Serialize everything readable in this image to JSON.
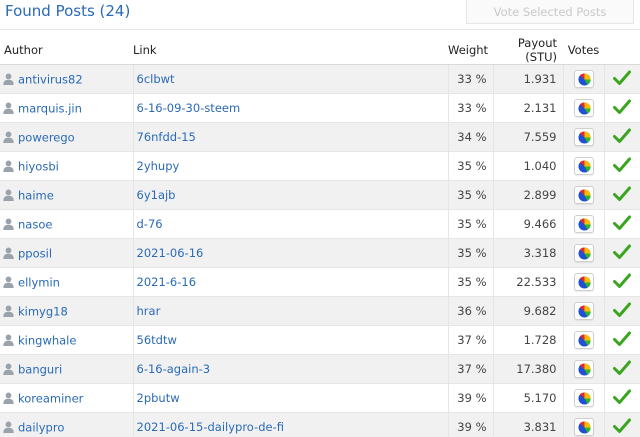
{
  "header": {
    "title": "Found Posts (24)",
    "vote_button_label": "Vote Selected Posts"
  },
  "columns": {
    "author": "Author",
    "link": "Link",
    "weight": "Weight",
    "payout": "Payout (STU)",
    "votes": "Votes"
  },
  "colors": {
    "accent": "#2a6ab8",
    "check": "#3aa51e",
    "row_alt": "#f1f1f1"
  },
  "rows": [
    {
      "author": "antivirus82",
      "link": "6clbwt",
      "weight": "33 %",
      "payout": "1.931"
    },
    {
      "author": "marquis.jin",
      "link": "6-16-09-30-steem",
      "weight": "33 %",
      "payout": "2.131"
    },
    {
      "author": "powerego",
      "link": "76nfdd-15",
      "weight": "34 %",
      "payout": "7.559"
    },
    {
      "author": "hiyosbi",
      "link": "2yhupy",
      "weight": "35 %",
      "payout": "1.040"
    },
    {
      "author": "haime",
      "link": "6y1ajb",
      "weight": "35 %",
      "payout": "2.899"
    },
    {
      "author": "nasoe",
      "link": "d-76",
      "weight": "35 %",
      "payout": "9.466"
    },
    {
      "author": "pposil",
      "link": "2021-06-16",
      "weight": "35 %",
      "payout": "3.318"
    },
    {
      "author": "ellymin",
      "link": "2021-6-16",
      "weight": "35 %",
      "payout": "22.533"
    },
    {
      "author": "kimyg18",
      "link": "hrar",
      "weight": "36 %",
      "payout": "9.682"
    },
    {
      "author": "kingwhale",
      "link": "56tdtw",
      "weight": "37 %",
      "payout": "1.728"
    },
    {
      "author": "banguri",
      "link": "6-16-again-3",
      "weight": "37 %",
      "payout": "17.380"
    },
    {
      "author": "koreaminer",
      "link": "2pbutw",
      "weight": "39 %",
      "payout": "5.170"
    },
    {
      "author": "dailypro",
      "link": "2021-06-15-dailypro-de-fi",
      "weight": "39 %",
      "payout": "3.831"
    }
  ],
  "icons": {
    "author": "user-icon",
    "votes": "pie-chart-icon",
    "select": "check-icon"
  }
}
